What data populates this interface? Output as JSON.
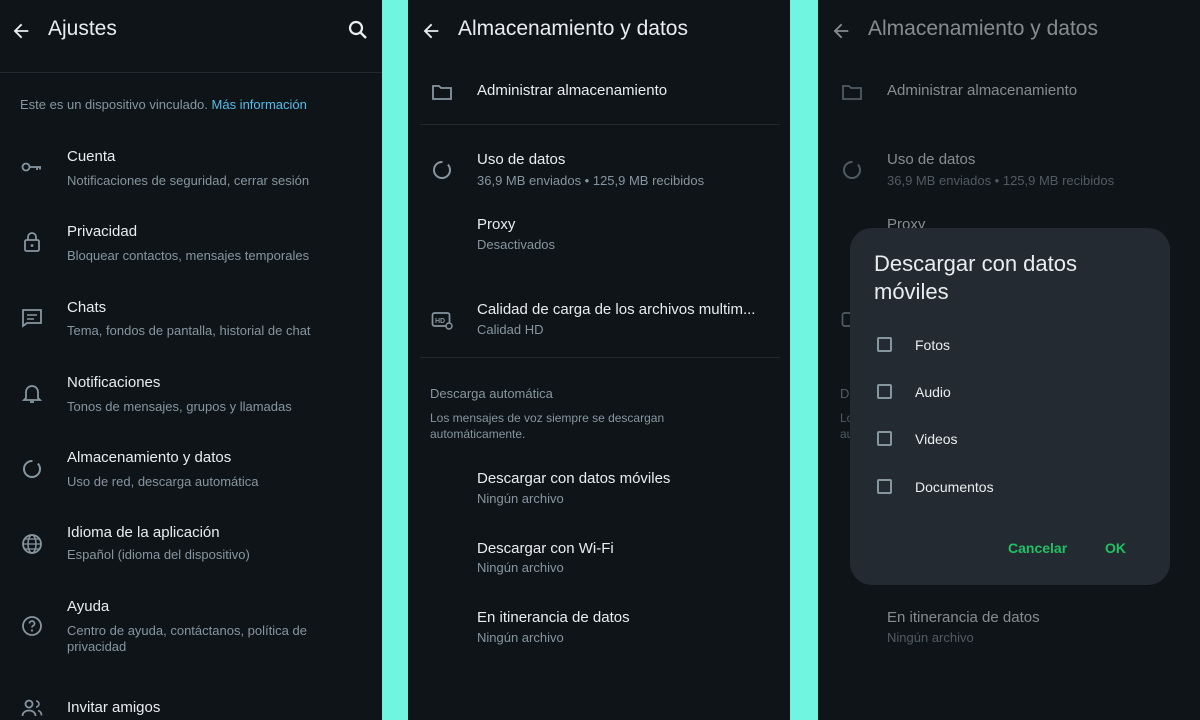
{
  "colors": {
    "accent_green": "#21c063",
    "link_blue": "#53bdeb",
    "background": "#0f1418",
    "frame": "#6ff5e0"
  },
  "settings": {
    "title": "Ajustes",
    "linked_note": "Este es un dispositivo vinculado.",
    "linked_link": "Más información",
    "items": [
      {
        "icon": "key-icon",
        "title": "Cuenta",
        "subtitle": "Notificaciones de seguridad, cerrar sesión"
      },
      {
        "icon": "lock-icon",
        "title": "Privacidad",
        "subtitle": "Bloquear contactos, mensajes temporales"
      },
      {
        "icon": "chat-icon",
        "title": "Chats",
        "subtitle": "Tema, fondos de pantalla, historial de chat"
      },
      {
        "icon": "bell-icon",
        "title": "Notificaciones",
        "subtitle": "Tonos de mensajes, grupos y llamadas"
      },
      {
        "icon": "storage-icon",
        "title": "Almacenamiento y datos",
        "subtitle": "Uso de red, descarga automática"
      },
      {
        "icon": "globe-icon",
        "title": "Idioma de la aplicación",
        "subtitle": "Español (idioma del dispositivo)"
      },
      {
        "icon": "help-icon",
        "title": "Ayuda",
        "subtitle": "Centro de ayuda, contáctanos, política de",
        "subtitle2": "privacidad"
      },
      {
        "icon": "people-icon",
        "title": "Invitar amigos",
        "subtitle": ""
      }
    ]
  },
  "storage": {
    "title": "Almacenamiento y datos",
    "manage": "Administrar almacenamiento",
    "data_usage": {
      "title": "Uso de datos",
      "subtitle": "36,9 MB enviados • 125,9 MB recibidos"
    },
    "proxy": {
      "title": "Proxy",
      "subtitle": "Desactivados"
    },
    "quality": {
      "title": "Calidad de carga de los archivos multim...",
      "subtitle": "Calidad HD"
    },
    "auto_download": {
      "header": "Descarga automática",
      "description": "Los mensajes de voz siempre se descargan automáticamente."
    },
    "mobile": {
      "title": "Descargar con datos móviles",
      "subtitle": "Ningún archivo"
    },
    "wifi": {
      "title": "Descargar con Wi-Fi",
      "subtitle": "Ningún archivo"
    },
    "roaming": {
      "title": "En itinerancia de datos",
      "subtitle": "Ningún archivo"
    }
  },
  "storage_bg": {
    "title": "Almacenamiento y datos",
    "manage": "Administrar almacenamiento",
    "data_usage_title": "Uso de datos",
    "data_usage_subtitle": "36,9 MB enviados • 125,9 MB recibidos",
    "proxy": "Proxy",
    "roaming_title": "En itinerancia de datos",
    "roaming_subtitle": "Ningún archivo",
    "cut_d": "D",
    "cut_lo": "Lo",
    "cut_au": "au"
  },
  "dialog": {
    "title": "Descargar con datos móviles",
    "options": [
      {
        "label": "Fotos",
        "checked": false
      },
      {
        "label": "Audio",
        "checked": false
      },
      {
        "label": "Videos",
        "checked": false
      },
      {
        "label": "Documentos",
        "checked": false
      }
    ],
    "cancel": "Cancelar",
    "ok": "OK"
  }
}
